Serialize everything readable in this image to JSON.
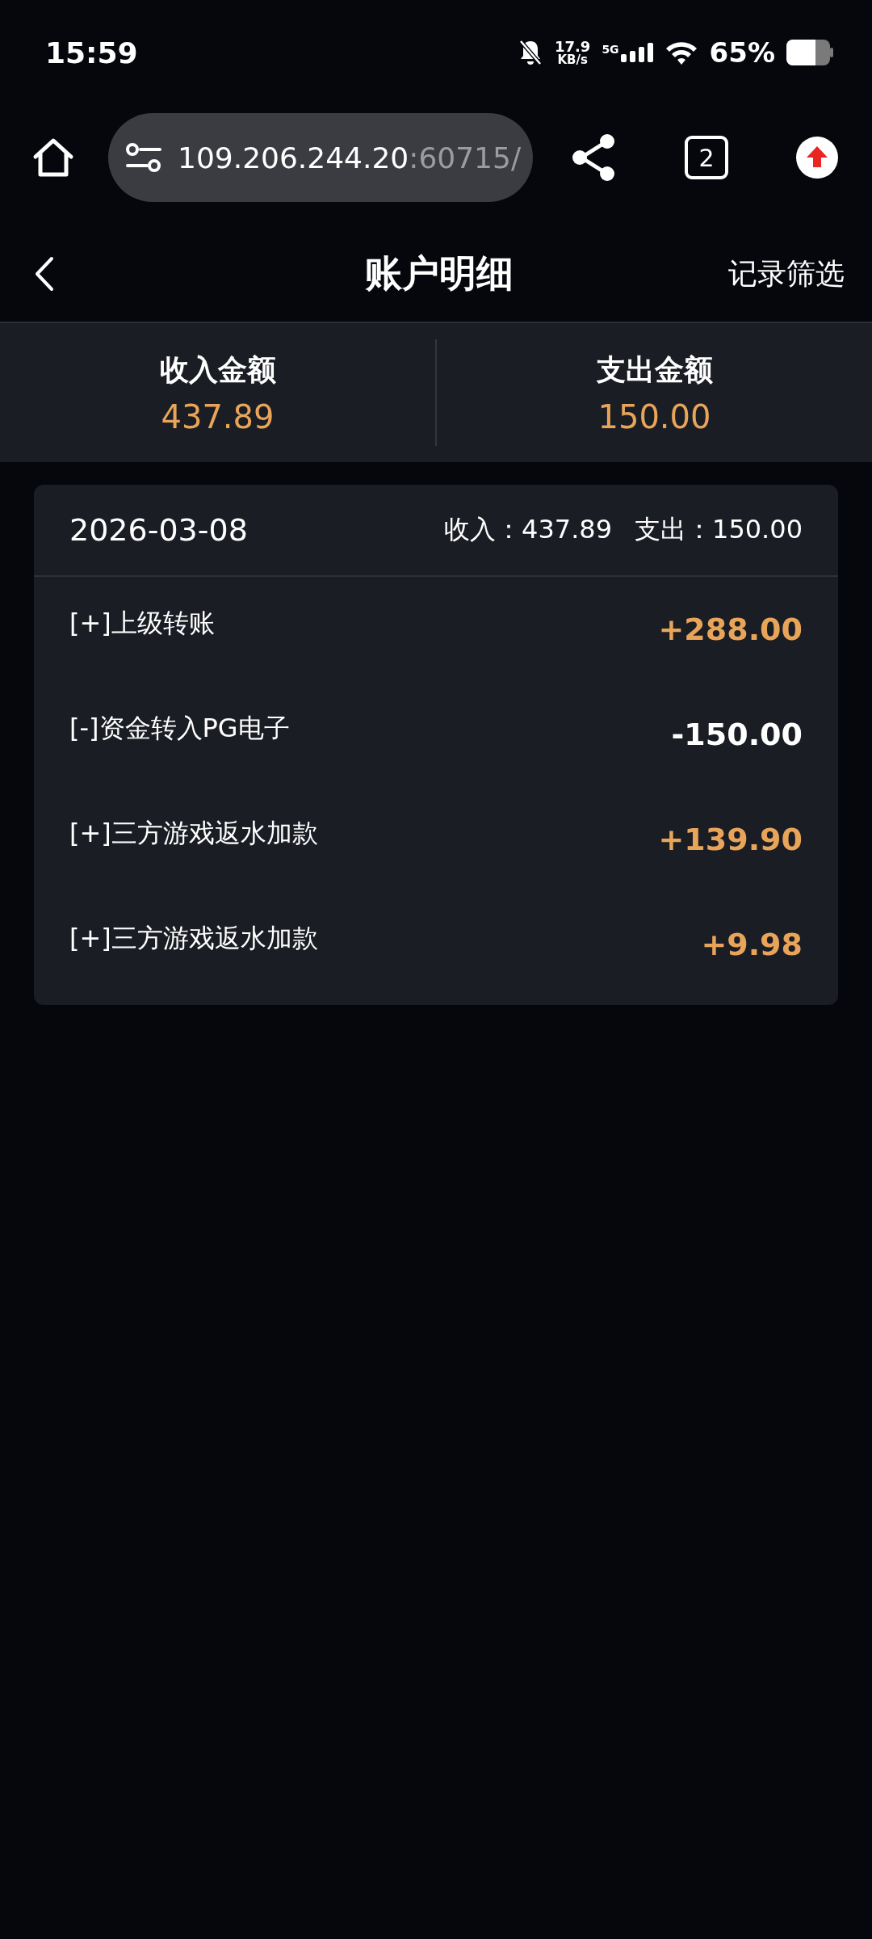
{
  "status_bar": {
    "time": "15:59",
    "speed_value": "17.9",
    "speed_unit": "KB/s",
    "network": "5G",
    "battery": "65%"
  },
  "browser_bar": {
    "url_host": "109.206.244.20",
    "url_rest": ":60715/",
    "tab_count": "2"
  },
  "header": {
    "title": "账户明细",
    "action": "记录筛选"
  },
  "summary": [
    {
      "label": "收入金额",
      "value": "437.89"
    },
    {
      "label": "支出金额",
      "value": "150.00"
    }
  ],
  "day": {
    "date": "2026-03-08",
    "income": "收入：437.89",
    "expense": "支出：150.00",
    "entries": [
      {
        "title": "[+]上级转账",
        "amount": "+288.00",
        "kind": "income"
      },
      {
        "title": "[-]资金转入PG电子",
        "amount": "-150.00",
        "kind": "expense"
      },
      {
        "title": "[+]三方游戏返水加款",
        "amount": "+139.90",
        "kind": "income"
      },
      {
        "title": "[+]三方游戏返水加款",
        "amount": "+9.98",
        "kind": "income"
      }
    ]
  }
}
